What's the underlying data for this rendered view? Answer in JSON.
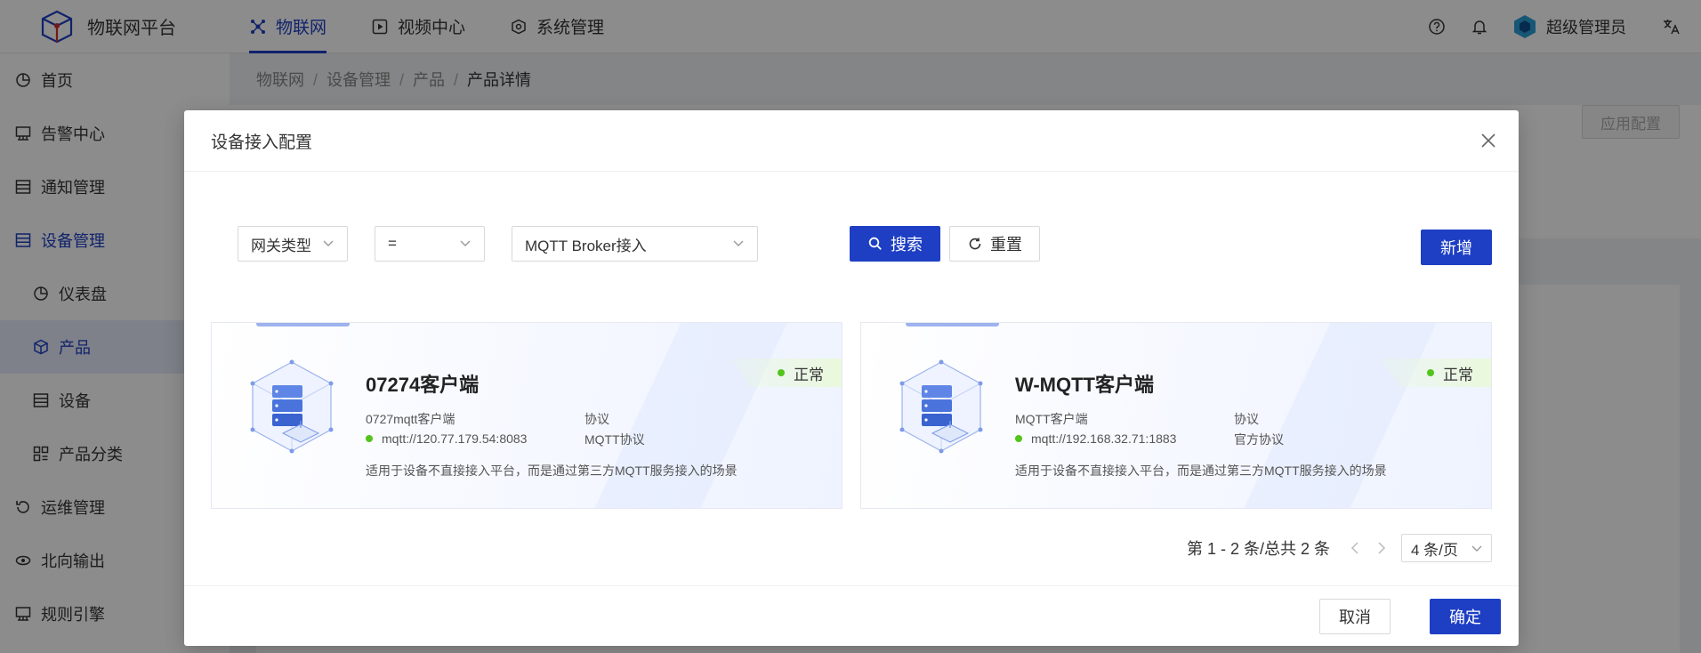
{
  "app": {
    "name": "物联网平台"
  },
  "topnav": [
    {
      "label": "物联网",
      "icon": "iot-icon"
    },
    {
      "label": "视频中心",
      "icon": "video-icon"
    },
    {
      "label": "系统管理",
      "icon": "settings-cube-icon"
    }
  ],
  "user": {
    "name": "超级管理员"
  },
  "sidebar": {
    "items": [
      {
        "label": "首页"
      },
      {
        "label": "告警中心"
      },
      {
        "label": "通知管理"
      },
      {
        "label": "设备管理"
      },
      {
        "label": "仪表盘"
      },
      {
        "label": "产品"
      },
      {
        "label": "设备"
      },
      {
        "label": "产品分类"
      },
      {
        "label": "运维管理"
      },
      {
        "label": "北向输出"
      },
      {
        "label": "规则引擎"
      }
    ]
  },
  "breadcrumb": [
    "物联网",
    "设备管理",
    "产品",
    "产品详情"
  ],
  "page": {
    "apply_label": "应用配置"
  },
  "modal": {
    "title": "设备接入配置",
    "filter": {
      "field": "网关类型",
      "operator": "=",
      "value": "MQTT Broker接入"
    },
    "search_label": "搜索",
    "reset_label": "重置",
    "add_label": "新增",
    "cards": [
      {
        "name": "07274客户端",
        "status": "正常",
        "description": "0727mqtt客户端",
        "address": "mqtt://120.77.179.54:8083",
        "protocol_label": "协议",
        "protocol": "MQTT协议",
        "scene": "适用于设备不直接接入平台，而是通过第三方MQTT服务接入的场景"
      },
      {
        "name": "W-MQTT客户端",
        "status": "正常",
        "description": "MQTT客户端",
        "address": "mqtt://192.168.32.71:1883",
        "protocol_label": "协议",
        "protocol": "官方协议",
        "scene": "适用于设备不直接接入平台，而是通过第三方MQTT服务接入的场景"
      }
    ],
    "pagination": {
      "summary": "第 1 - 2 条/总共 2 条",
      "page_size": "4 条/页"
    },
    "cancel_label": "取消",
    "confirm_label": "确定"
  },
  "colors": {
    "primary": "#1e3fc4",
    "status_ok": "#52c41a"
  }
}
